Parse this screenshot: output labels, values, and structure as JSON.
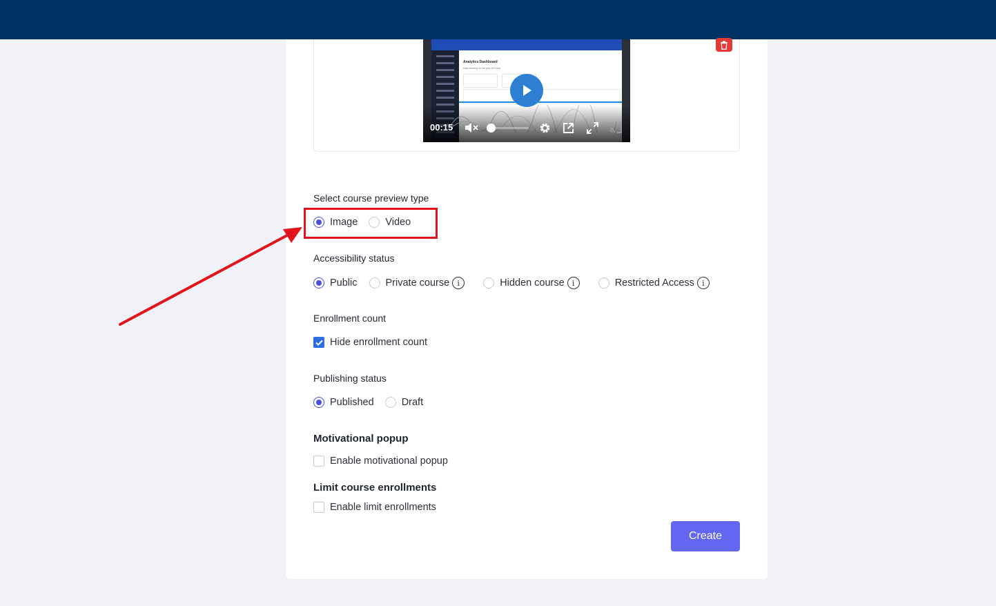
{
  "video": {
    "timestamp": "00:15",
    "volume_fraction": 0.0,
    "shot_title": "Analytics Dashboard",
    "shot_subtitle": "Data showing for the past 30 hours"
  },
  "preview_type": {
    "label": "Select course preview type",
    "options": [
      "Image",
      "Video"
    ],
    "selected": "Image"
  },
  "accessibility": {
    "label": "Accessibility status",
    "options": [
      "Public",
      "Private course",
      "Hidden course",
      "Restricted Access"
    ],
    "selected": "Public"
  },
  "enrollment_count": {
    "label": "Enrollment count",
    "checkbox_label": "Hide enrollment count",
    "checked": true
  },
  "publishing": {
    "label": "Publishing status",
    "options": [
      "Published",
      "Draft"
    ],
    "selected": "Published"
  },
  "motivational": {
    "label": "Motivational popup",
    "checkbox_label": "Enable motivational popup",
    "checked": false
  },
  "limit": {
    "label": "Limit course enrollments",
    "checkbox_label": "Enable limit enrollments",
    "checked": false
  },
  "create_label": "Create",
  "colors": {
    "header": "#003264",
    "primary": "#6366f1",
    "radio_accent": "#4a4ee8",
    "annotation": "#e2131b",
    "delete": "#e53935"
  }
}
